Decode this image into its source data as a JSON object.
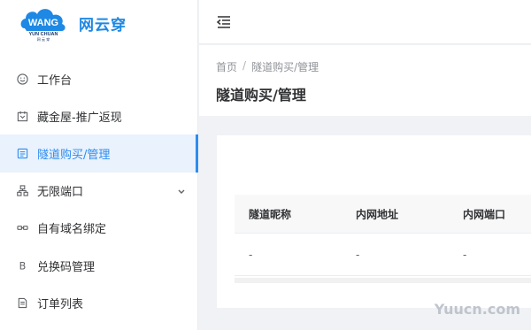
{
  "brand": {
    "logo_text": "WANG",
    "logo_subtext": "YUN CHUAN",
    "logo_tiny": "网 云 穿",
    "name": "网云穿"
  },
  "sidebar": {
    "items": [
      {
        "label": "工作台",
        "icon": "smile-icon",
        "active": false
      },
      {
        "label": "藏金屋-推广返现",
        "icon": "treasure-box-icon",
        "active": false
      },
      {
        "label": "隧道购买/管理",
        "icon": "tunnel-icon",
        "active": true
      },
      {
        "label": "无限端口",
        "icon": "network-icon",
        "active": false,
        "expandable": true
      },
      {
        "label": "自有域名绑定",
        "icon": "link-icon",
        "active": false
      },
      {
        "label": "兑换码管理",
        "icon": "letter-b-icon",
        "active": false
      },
      {
        "label": "订单列表",
        "icon": "document-icon",
        "active": false
      }
    ]
  },
  "header": {
    "breadcrumb": [
      "首页",
      "隧道购买/管理"
    ],
    "breadcrumb_separator": "/",
    "title": "隧道购买/管理"
  },
  "table": {
    "columns": [
      "隧道昵称",
      "内网地址",
      "内网端口"
    ],
    "rows": [
      [
        "-",
        "-",
        "-"
      ]
    ]
  },
  "watermark": "Yuucn.com",
  "colors": {
    "accent": "#2d8cf0",
    "brand": "#1e88e5",
    "active_bg": "#e9f2fd"
  }
}
